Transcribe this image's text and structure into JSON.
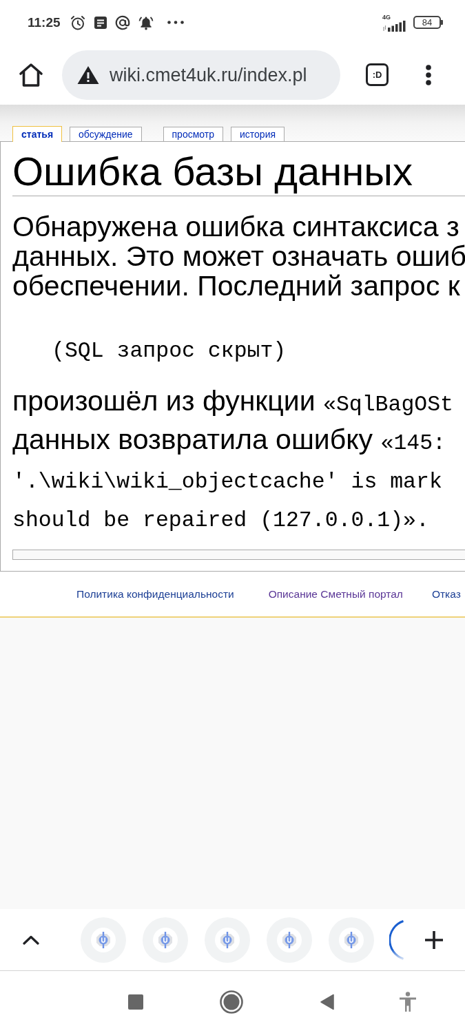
{
  "status_bar": {
    "time": "11:25",
    "network_type": "4G",
    "battery": "84"
  },
  "toolbar": {
    "url": "wiki.cmet4uk.ru/index.pl",
    "tab_switcher": ":D"
  },
  "page_tabs": [
    [
      {
        "label": "статья",
        "selected": true
      },
      {
        "label": "обсуждение",
        "selected": false
      }
    ],
    [
      {
        "label": "просмотр",
        "selected": false
      },
      {
        "label": "история",
        "selected": false
      }
    ]
  ],
  "article": {
    "title": "Ошибка базы данных",
    "intro_lines": [
      "Обнаружена ошибка синтаксиса з",
      "данных. Это может означать ошиб",
      "обеспечении. Последний запрос к"
    ],
    "query": "(SQL запрос скрыт)",
    "detail_lines": [
      [
        {
          "kind": "text",
          "text": "произошёл из функции "
        },
        {
          "kind": "code",
          "text": "«SqlBagOSt"
        }
      ],
      [
        {
          "kind": "text",
          "text": "данных возвратила ошибку "
        },
        {
          "kind": "code",
          "text": "«145:"
        }
      ],
      [
        {
          "kind": "code",
          "text": "'.\\wiki\\wiki_objectcache' is mark"
        }
      ],
      [
        {
          "kind": "code",
          "text": "should be repaired (127.0.0.1)»."
        }
      ]
    ]
  },
  "footer_links": [
    {
      "label": "Политика конфиденциальности",
      "visited": false
    },
    {
      "label": "Описание Сметный портал",
      "visited": true
    },
    {
      "label": "Отказ",
      "visited": false
    }
  ],
  "tab_strip": [
    {
      "kind": "favicon"
    },
    {
      "kind": "favicon"
    },
    {
      "kind": "favicon"
    },
    {
      "kind": "favicon"
    },
    {
      "kind": "favicon"
    },
    {
      "kind": "loading"
    }
  ]
}
